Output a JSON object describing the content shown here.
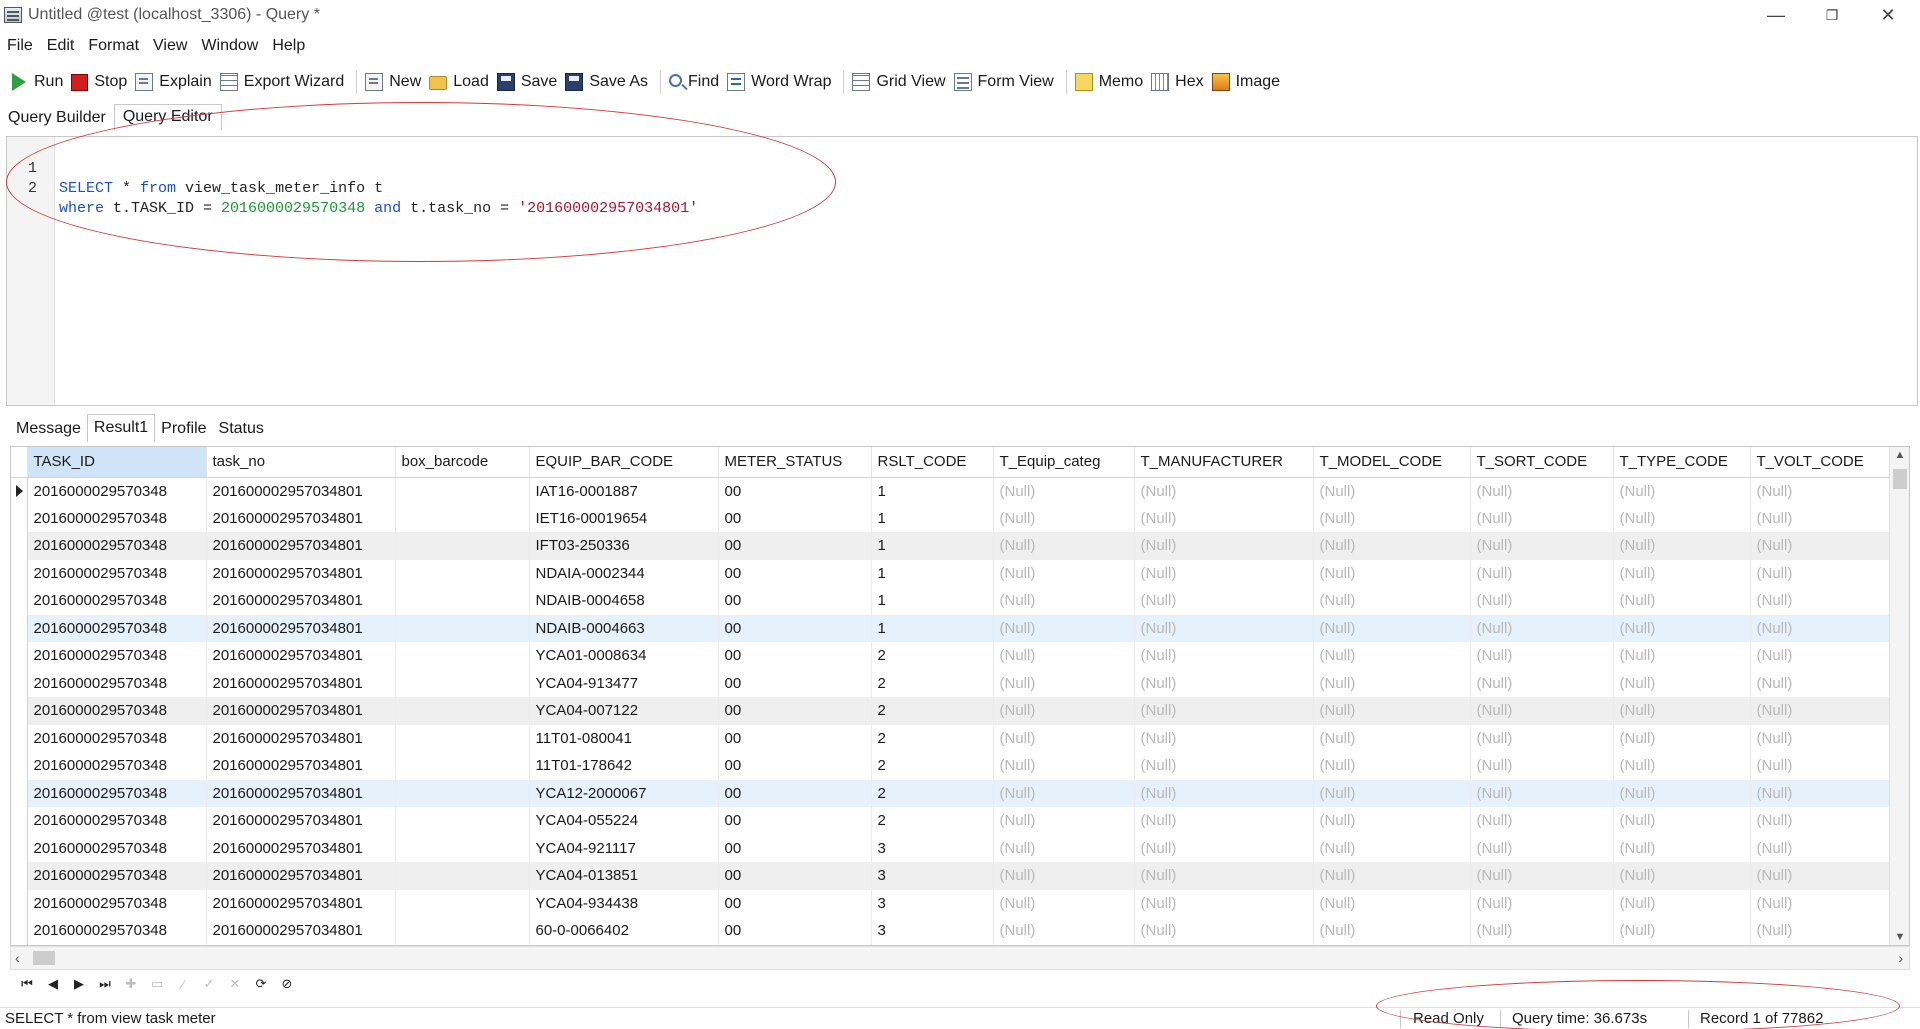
{
  "window": {
    "title": "Untitled @test (localhost_3306) - Query *",
    "minimize": "—",
    "restore": "❐",
    "close": "✕"
  },
  "menu": [
    "File",
    "Edit",
    "Format",
    "View",
    "Window",
    "Help"
  ],
  "toolbar": {
    "run": "Run",
    "stop": "Stop",
    "explain": "Explain",
    "export_wizard": "Export Wizard",
    "new": "New",
    "load": "Load",
    "save": "Save",
    "save_as": "Save As",
    "find": "Find",
    "word_wrap": "Word Wrap",
    "grid_view": "Grid View",
    "form_view": "Form View",
    "memo": "Memo",
    "hex": "Hex",
    "image": "Image"
  },
  "editor_tabs": [
    "Query Builder",
    "Query Editor"
  ],
  "editor": {
    "line_numbers": [
      "1",
      "2"
    ],
    "line1": {
      "kw1": "SELECT",
      "t1": " * ",
      "kw2": "from",
      "t2": " view_task_meter_info t"
    },
    "line2": {
      "kw1": "where",
      "t1": " t.TASK_ID = ",
      "num": "2016000029570348",
      "t2": " ",
      "kw2": "and",
      "t3": " t.task_no = ",
      "str": "'201600002957034801'"
    }
  },
  "result_tabs": [
    "Message",
    "Result1",
    "Profile",
    "Status"
  ],
  "grid": {
    "columns": [
      "TASK_ID",
      "task_no",
      "box_barcode",
      "EQUIP_BAR_CODE",
      "METER_STATUS",
      "RSLT_CODE",
      "T_Equip_categ",
      "T_MANUFACTURER",
      "T_MODEL_CODE",
      "T_SORT_CODE",
      "T_TYPE_CODE",
      "T_VOLT_CODE"
    ],
    "null_text": "(Null)",
    "rows": [
      [
        "2016000029570348",
        "201600002957034801",
        "",
        "IAT16-0001887",
        "00",
        "1"
      ],
      [
        "2016000029570348",
        "201600002957034801",
        "",
        "IET16-00019654",
        "00",
        "1"
      ],
      [
        "2016000029570348",
        "201600002957034801",
        "",
        "IFT03-250336",
        "00",
        "1"
      ],
      [
        "2016000029570348",
        "201600002957034801",
        "",
        "NDAIA-0002344",
        "00",
        "1"
      ],
      [
        "2016000029570348",
        "201600002957034801",
        "",
        "NDAIB-0004658",
        "00",
        "1"
      ],
      [
        "2016000029570348",
        "201600002957034801",
        "",
        "NDAIB-0004663",
        "00",
        "1"
      ],
      [
        "2016000029570348",
        "201600002957034801",
        "",
        "YCA01-0008634",
        "00",
        "2"
      ],
      [
        "2016000029570348",
        "201600002957034801",
        "",
        "YCA04-913477",
        "00",
        "2"
      ],
      [
        "2016000029570348",
        "201600002957034801",
        "",
        "YCA04-007122",
        "00",
        "2"
      ],
      [
        "2016000029570348",
        "201600002957034801",
        "",
        "11T01-080041",
        "00",
        "2"
      ],
      [
        "2016000029570348",
        "201600002957034801",
        "",
        "11T01-178642",
        "00",
        "2"
      ],
      [
        "2016000029570348",
        "201600002957034801",
        "",
        "YCA12-2000067",
        "00",
        "2"
      ],
      [
        "2016000029570348",
        "201600002957034801",
        "",
        "YCA04-055224",
        "00",
        "2"
      ],
      [
        "2016000029570348",
        "201600002957034801",
        "",
        "YCA04-921117",
        "00",
        "3"
      ],
      [
        "2016000029570348",
        "201600002957034801",
        "",
        "YCA04-013851",
        "00",
        "3"
      ],
      [
        "2016000029570348",
        "201600002957034801",
        "",
        "YCA04-934438",
        "00",
        "3"
      ],
      [
        "2016000029570348",
        "201600002957034801",
        "",
        "60-0-0066402",
        "00",
        "3"
      ]
    ]
  },
  "nav_buttons": [
    {
      "name": "first-record-button",
      "glyph": "⏮",
      "enabled": true
    },
    {
      "name": "prev-record-button",
      "glyph": "◀",
      "enabled": true
    },
    {
      "name": "next-record-button",
      "glyph": "▶",
      "enabled": true
    },
    {
      "name": "last-record-button",
      "glyph": "⏭",
      "enabled": true
    },
    {
      "name": "add-record-button",
      "glyph": "✚",
      "enabled": false
    },
    {
      "name": "delete-record-button",
      "glyph": "▭",
      "enabled": false
    },
    {
      "name": "edit-record-button",
      "glyph": "∕",
      "enabled": false
    },
    {
      "name": "apply-changes-button",
      "glyph": "✓",
      "enabled": false
    },
    {
      "name": "discard-changes-button",
      "glyph": "✕",
      "enabled": false
    },
    {
      "name": "refresh-button",
      "glyph": "⟳",
      "enabled": true
    },
    {
      "name": "stop-button",
      "glyph": "⊘",
      "enabled": true
    }
  ],
  "status": {
    "query_text": "SELECT * from view task meter",
    "read_only": "Read Only",
    "query_time": "Query time: 36.673s",
    "record": "Record 1 of 77862"
  },
  "colors": {
    "keyword": "#1b4fd1",
    "number": "#1c9b34",
    "string": "#b0142a",
    "annotation": "#d23a3a",
    "selected_header": "#cfe4f7",
    "highlight_row": "#e7f1fb"
  }
}
